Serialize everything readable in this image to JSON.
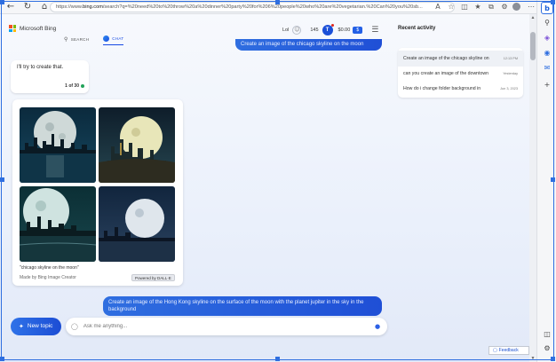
{
  "browser": {
    "url_prefix": "https://www.",
    "url_domain": "bing.com",
    "url_rest": "/search?q=%20need%20to%20throw%20a%20dinner%20party%20for%206%20people%20who%20are%20vegetarian.%20Can%20you%20sb..."
  },
  "app": {
    "logo_text": "Microsoft Bing",
    "tabs": [
      {
        "label": "SEARCH"
      },
      {
        "label": "CHAT"
      }
    ],
    "user_name": "Lol",
    "points": "145",
    "balance": "$0.00",
    "coin_label": "$"
  },
  "chat": {
    "prompt_top": "Create an image of the chicago skyline on the moon",
    "bot_reply": "I'll try to create that.",
    "bot_count": "1 of 30",
    "image_caption": "\"chicago skyline on the moon\"",
    "made_by": "Made by Bing Image Creator",
    "powered_by": "Powered by DALL·E",
    "prompt_bottom": "Create an image of the Hong Kong skyline on the surface of the moon with the planet jupiter in the sky in the background"
  },
  "composer": {
    "new_topic": "New topic",
    "placeholder": "Ask me anything..."
  },
  "recent": {
    "title": "Recent activity",
    "items": [
      {
        "text": "Create an image of the chicago skyline on",
        "date": "12:13 PM"
      },
      {
        "text": "can you create an image of the downtown",
        "date": "Yesterday"
      },
      {
        "text": "How do i change folder background in",
        "date": "Jun 3, 2023"
      }
    ]
  },
  "feedback_label": "Feedback",
  "icons": {
    "back": "arrow-left-icon",
    "refresh": "refresh-icon",
    "home": "home-icon",
    "favorite": "star-icon",
    "search_tab": "search-icon",
    "chat_tab": "chat-icon",
    "menu": "hamburger-icon",
    "mic": "microphone-icon",
    "broom": "broom-icon"
  },
  "colors": {
    "accent": "#1b4fd8",
    "bubble": "#2f6ee0"
  }
}
